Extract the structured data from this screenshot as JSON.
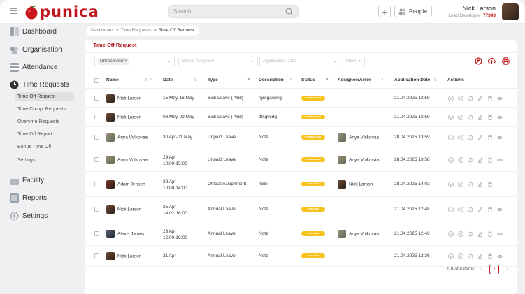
{
  "app": {
    "logo_text": "punica",
    "brand_color": "#c0161d"
  },
  "topbar": {
    "search_placeholder": "Search",
    "people_label": "People",
    "user_name": "Nick Larson",
    "user_role": "Lead Developer",
    "user_id": "77343"
  },
  "sidebar": {
    "items": [
      {
        "label": "Dashboard",
        "icon": "dashboard-icon"
      },
      {
        "label": "Organisation",
        "icon": "organisation-icon"
      },
      {
        "label": "Attendance",
        "icon": "attendance-icon"
      },
      {
        "label": "Time Requests",
        "icon": "clock-icon"
      },
      {
        "label": "Facility",
        "icon": "facility-icon"
      },
      {
        "label": "Reports",
        "icon": "reports-icon"
      },
      {
        "label": "Settings",
        "icon": "gear-icon"
      }
    ],
    "sub_items": [
      "Time Off Request",
      "Time Comp. Requests",
      "Overtime Requests",
      "Time Off Report",
      "Bonus Time Off",
      "Settings"
    ]
  },
  "breadcrumb": {
    "a": "Dashboard",
    "b": "Time Requests",
    "c": "Time Off Request",
    "sep": ">"
  },
  "tab": {
    "label": "Time Off Request"
  },
  "filters": {
    "status_chip": "Unresolved",
    "assignee_placeholder": "Select Assignee",
    "date_placeholder": "Application Date",
    "more_label": "More"
  },
  "table": {
    "headers": [
      "Name",
      "Date",
      "Type",
      "Description",
      "Status",
      "Assignee/Actor",
      "Application Date",
      "Actions"
    ],
    "rows": [
      {
        "name": "Nick Larson",
        "date1": "15 May-16 May",
        "date2": "",
        "type": "Sick Leave (Paid)",
        "desc": "rgregawerg",
        "status": "TOP MANAGER",
        "assignee": "",
        "app_date": "21.04.2025 12:59",
        "eye": true
      },
      {
        "name": "Nick Larson",
        "date1": "08 May-09 May",
        "date2": "",
        "type": "Sick Leave (Paid)",
        "desc": "dfsgvsdg",
        "status": "TOP MANAGER",
        "assignee": "",
        "app_date": "21.04.2025 12:59",
        "eye": true
      },
      {
        "name": "Anya Volkovaa",
        "date1": "30 Apr-01 May",
        "date2": "",
        "type": "Unpaid Leave",
        "desc": "Note",
        "status": "TOP MANAGER",
        "assignee": "Anya Volkovaa",
        "app_date": "28.04.2025 13:59",
        "eye": true
      },
      {
        "name": "Anya Volkovaa",
        "date1": "29 Apr",
        "date2": "10:00-15:00",
        "type": "Unpaid Leave",
        "desc": "Note",
        "status": "TOP MANAGER",
        "assignee": "Anya Volkovaa",
        "app_date": "28.04.2025 13:58",
        "eye": true
      },
      {
        "name": "Adam Jensen",
        "date1": "29 Apr",
        "date2": "10:00-14:00",
        "type": "Official Assignment",
        "desc": "note",
        "status": "MANAGER",
        "assignee": "Nick Larson",
        "app_date": "28.04.2025 14:03",
        "eye": false
      },
      {
        "name": "Nick Larson",
        "date1": "25 Apr",
        "date2": "14:02-16:00",
        "type": "Annual Leave",
        "desc": "Note",
        "status": "MANAGER",
        "assignee": "",
        "app_date": "21.04.2025 12:48",
        "eye": true
      },
      {
        "name": "Alexis James",
        "date1": "23 Apr",
        "date2": "12:00-16:00",
        "type": "Annual Leave",
        "desc": "Note",
        "status": "MANAGER",
        "assignee": "Anya Volkovaa",
        "app_date": "21.04.2025 12:49",
        "eye": true
      },
      {
        "name": "Nick Larson",
        "date1": "21 Apr",
        "date2": "",
        "type": "Annual Leave",
        "desc": "Note",
        "status": "MANAGER",
        "assignee": "",
        "app_date": "21.04.2025 12:36",
        "eye": true
      }
    ]
  },
  "pagination": {
    "summary": "1-8 of 8 items",
    "page": "1",
    "prev": "‹",
    "next": "›"
  }
}
